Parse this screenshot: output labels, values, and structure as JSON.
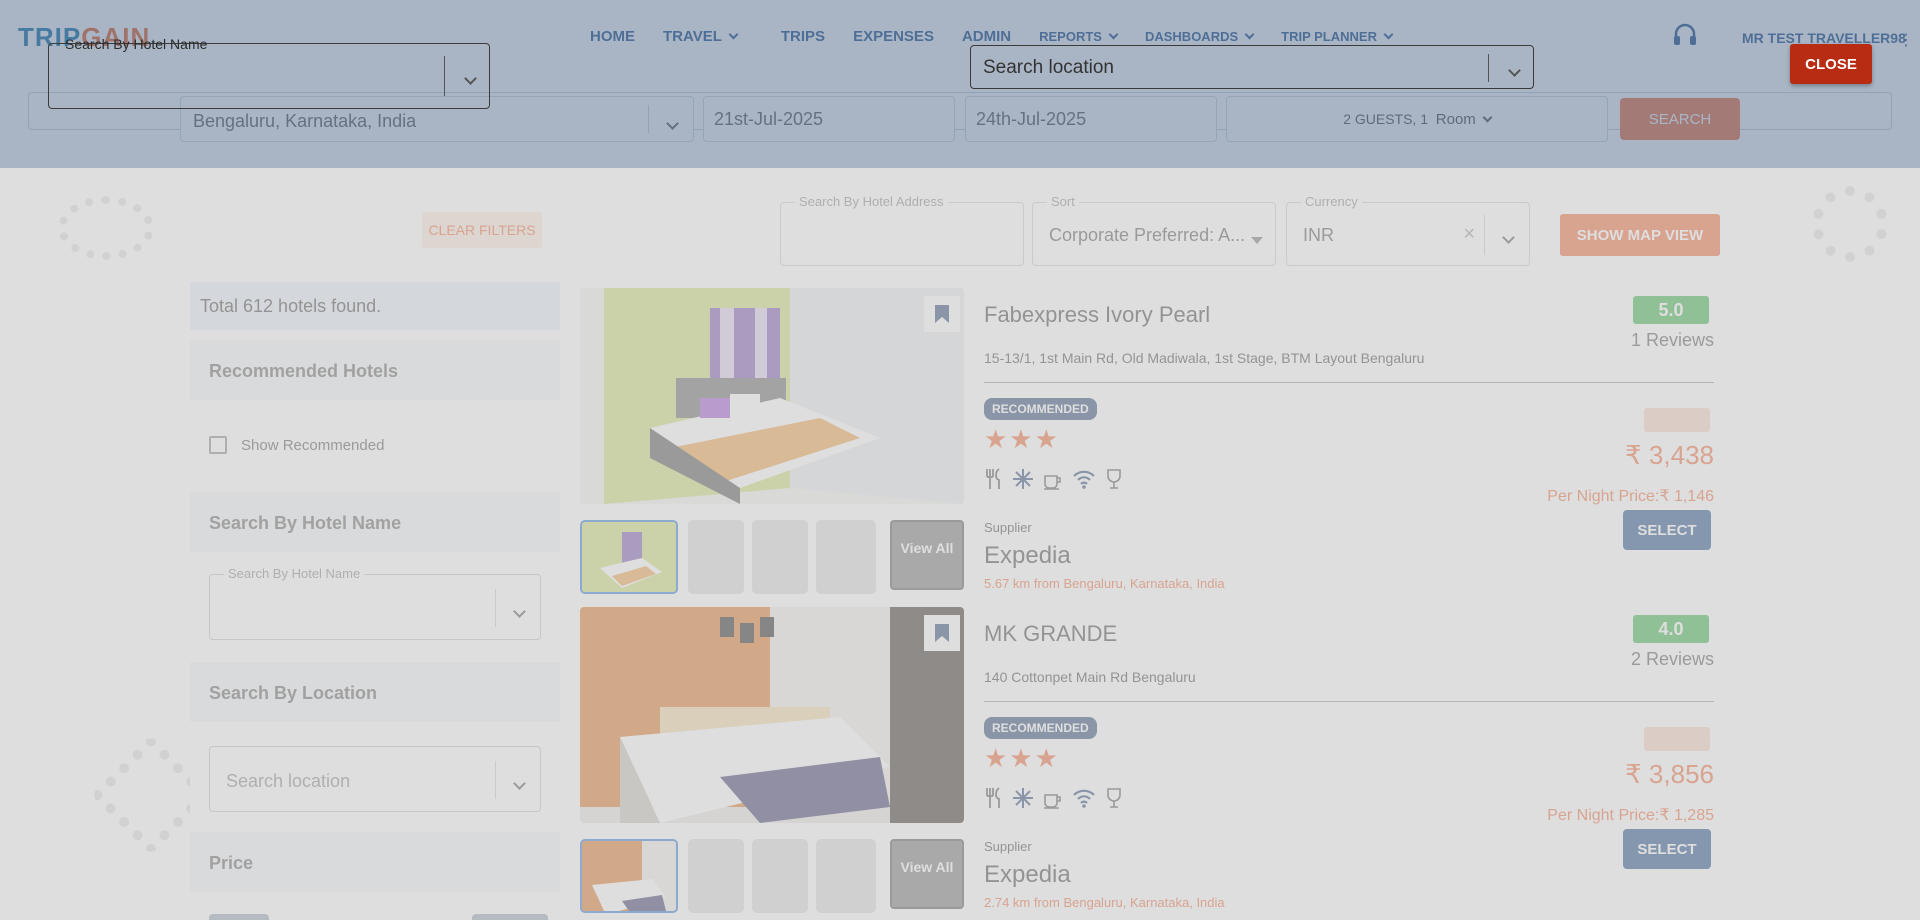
{
  "header": {
    "logo_part1": "TRIP",
    "logo_part2": "GAIN",
    "nav": [
      {
        "label": "HOME"
      },
      {
        "label": "TRAVEL"
      },
      {
        "label": "TRIPS"
      },
      {
        "label": "EXPENSES"
      },
      {
        "label": "ADMIN"
      },
      {
        "label": "REPORTS"
      },
      {
        "label": "DASHBOARDS"
      },
      {
        "label": "TRIP PLANNER"
      }
    ],
    "user_name": "MR TEST TRAVELLER98"
  },
  "search_bar": {
    "location": "Bengaluru, Karnataka, India",
    "check_in": "21st-Jul-2025",
    "check_out": "24th-Jul-2025",
    "guests": "2 GUESTS, 1",
    "room": "Room",
    "search_label": "SEARCH"
  },
  "modal": {
    "hotel_name_label": "Search By Hotel Name",
    "location_placeholder": "Search location",
    "close_label": "CLOSE"
  },
  "sidebar": {
    "clear_filters": "CLEAR FILTERS",
    "total": "Total 612 hotels found.",
    "recommended_heading": "Recommended Hotels",
    "show_recommended": "Show Recommended",
    "hotel_name_heading": "Search By Hotel Name",
    "hotel_name_label": "Search By Hotel Name",
    "location_heading": "Search By Location",
    "location_placeholder": "Search location",
    "price_heading": "Price"
  },
  "filters": {
    "address_label": "Search By Hotel Address",
    "sort_label": "Sort",
    "sort_value": "Corporate Preferred: A...",
    "currency_label": "Currency",
    "currency_value": "INR",
    "map_view": "SHOW MAP VIEW"
  },
  "hotels": [
    {
      "name": "Fabexpress Ivory Pearl",
      "address": "15-13/1, 1st Main Rd, Old Madiwala, 1st Stage, BTM Layout Bengaluru",
      "badge": "RECOMMENDED",
      "stars": "★★★",
      "rating": "5.0",
      "reviews": "1 Reviews",
      "price": "₹ 3,438",
      "per_night": "Per Night Price:₹ 1,146",
      "select": "SELECT",
      "supplier_label": "Supplier",
      "supplier": "Expedia",
      "distance": "5.67 km from Bengaluru, Karnataka, India",
      "view_all": "View All"
    },
    {
      "name": "MK GRANDE",
      "address": "140 Cottonpet Main Rd Bengaluru",
      "badge": "RECOMMENDED",
      "stars": "★★★",
      "rating": "4.0",
      "reviews": "2 Reviews",
      "price": "₹ 3,856",
      "per_night": "Per Night Price:₹ 1,285",
      "select": "SELECT",
      "supplier_label": "Supplier",
      "supplier": "Expedia",
      "distance": "2.74 km from Bengaluru, Karnataka, India",
      "view_all": "View All"
    }
  ],
  "colors": {
    "brand_blue": "#1d4e89",
    "accent_orange": "#f06a3a",
    "close_red": "#b82c13",
    "rating_green": "#3cb44b"
  }
}
